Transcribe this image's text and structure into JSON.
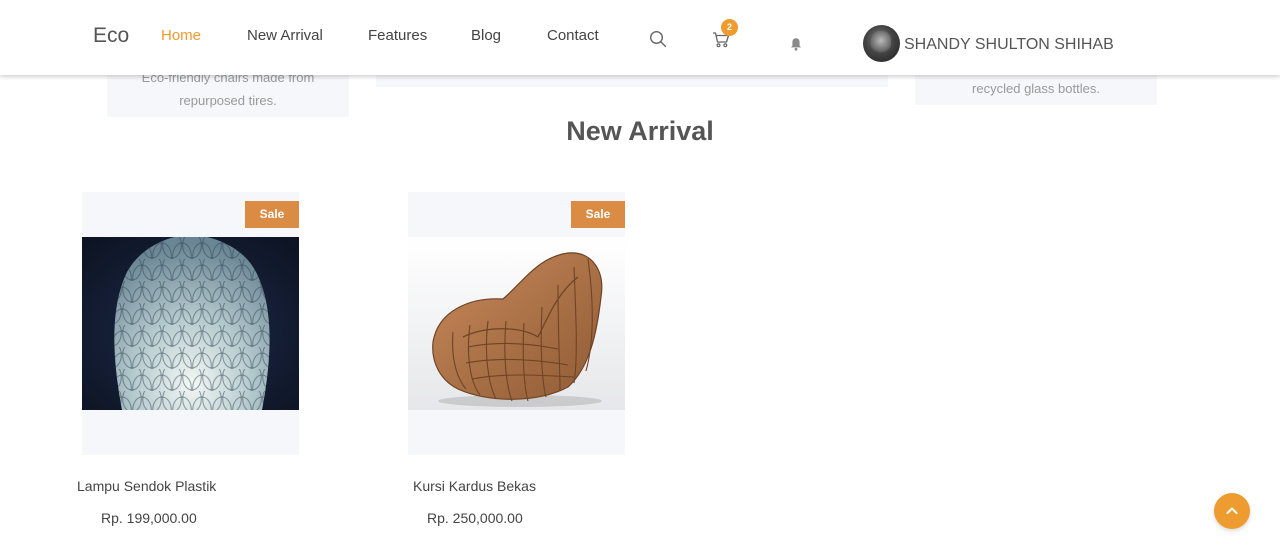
{
  "header": {
    "logo": "Eco",
    "nav": [
      "Home",
      "New Arrival",
      "Features",
      "Blog",
      "Contact"
    ],
    "active_nav": "Home",
    "cart_count": "2",
    "user_name": "SHANDY SHULTON SHIHAB"
  },
  "previous_section": {
    "left_card_text": "Eco-friendly chairs made from repurposed tires.",
    "right_card_text": "recycled glass bottles."
  },
  "new_arrival": {
    "title": "New Arrival",
    "products": [
      {
        "name": "Lampu Sendok Plastik",
        "price": "Rp. 199,000.00",
        "badge": "Sale"
      },
      {
        "name": "Kursi Kardus Bekas",
        "price": "Rp. 250,000.00",
        "badge": "Sale"
      }
    ]
  },
  "colors": {
    "accent": "#ee9b2f",
    "sale_badge": "#da8c45",
    "card_bg": "#f6f7fb"
  },
  "icons": [
    "search-icon",
    "cart-icon",
    "bell-icon",
    "chevron-up-icon"
  ]
}
